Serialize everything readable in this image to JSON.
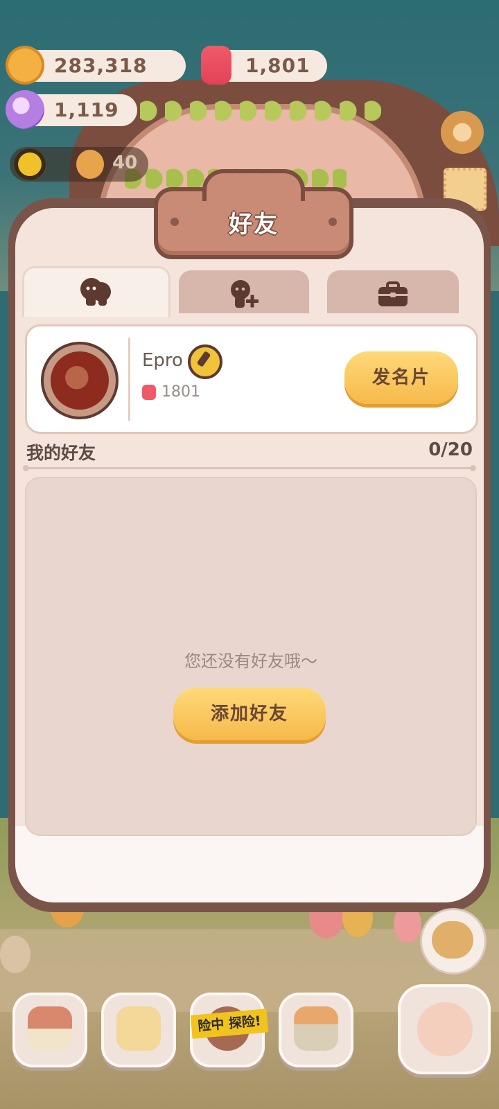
{
  "resources": {
    "coins": "283,318",
    "candles": "1,801",
    "crystals": "1,119"
  },
  "level_bar": {
    "value": "40"
  },
  "modal": {
    "title": "好友",
    "tabs": [
      {
        "name": "friends-tab",
        "icon": "friends-icon"
      },
      {
        "name": "add-friend-tab",
        "icon": "add-friend-icon"
      },
      {
        "name": "gift-tab",
        "icon": "briefcase-icon"
      }
    ],
    "profile": {
      "name": "Epro",
      "candle_count": "1801",
      "card_button": "发名片"
    },
    "friends_section": {
      "title": "我的好友",
      "count": "0/20",
      "empty_text": "您还没有好友哦～",
      "add_button": "添加好友"
    }
  },
  "bottom_nav": {
    "adventure_tape": "险中 探险!"
  },
  "colors": {
    "accent_button": "#f6b94a",
    "modal_border": "#7a5349",
    "modal_bg": "#f4e4dc"
  }
}
